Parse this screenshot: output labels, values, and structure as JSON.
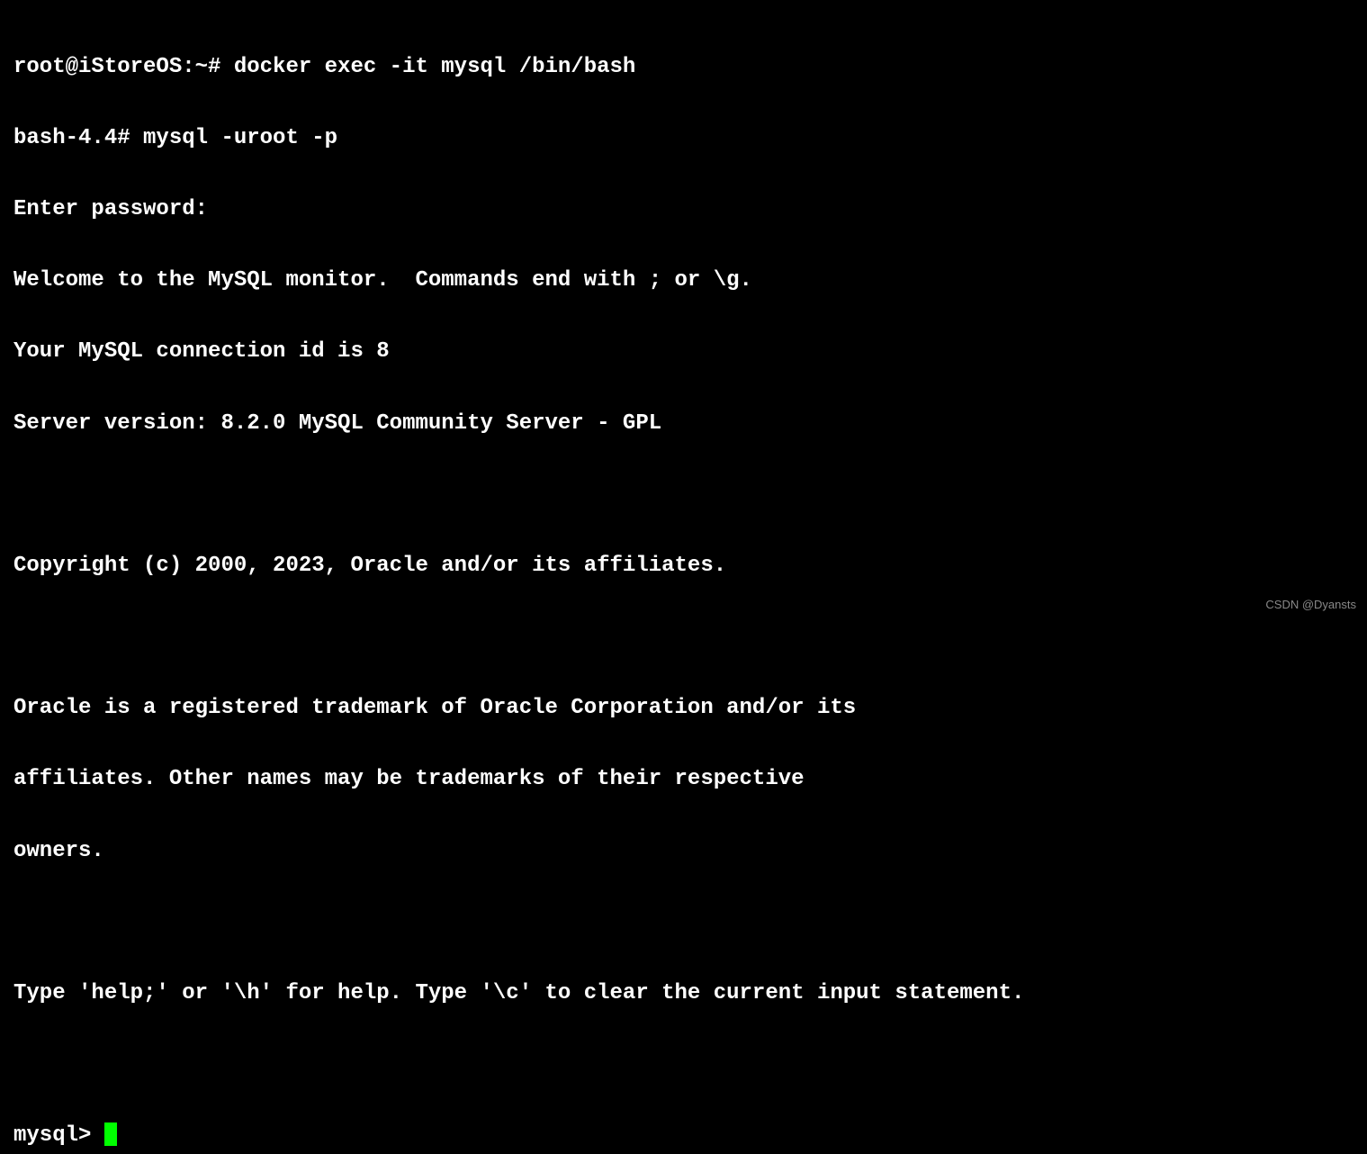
{
  "terminal": {
    "lines": [
      "root@iStoreOS:~# docker exec -it mysql /bin/bash",
      "bash-4.4# mysql -uroot -p",
      "Enter password:",
      "Welcome to the MySQL monitor.  Commands end with ; or \\g.",
      "Your MySQL connection id is 8",
      "Server version: 8.2.0 MySQL Community Server - GPL",
      "",
      "Copyright (c) 2000, 2023, Oracle and/or its affiliates.",
      "",
      "Oracle is a registered trademark of Oracle Corporation and/or its",
      "affiliates. Other names may be trademarks of their respective",
      "owners.",
      "",
      "Type 'help;' or '\\h' for help. Type '\\c' to clear the current input statement.",
      ""
    ],
    "prompt": "mysql> ",
    "watermark": "CSDN @Dyansts"
  }
}
